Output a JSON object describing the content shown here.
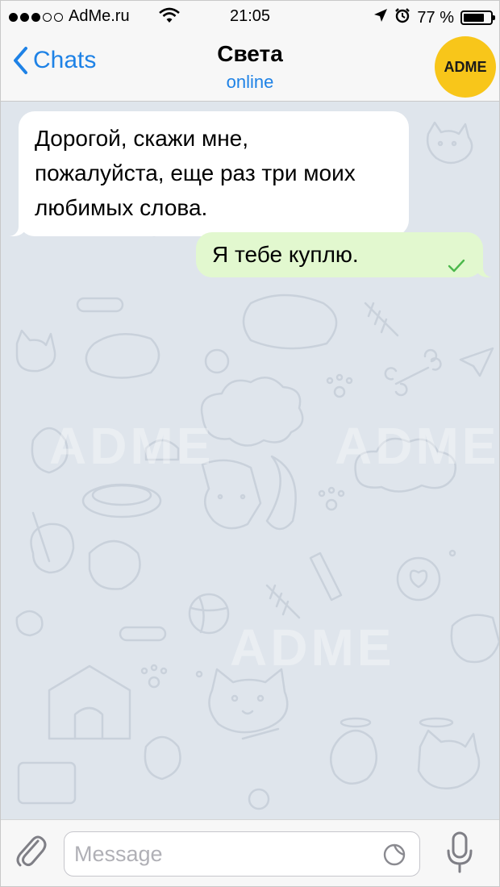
{
  "status_bar": {
    "carrier": "AdMe.ru",
    "time": "21:05",
    "battery": "77 %",
    "signal_strength": "3 of 5",
    "battery_level": 0.77,
    "icons": [
      "signal-dots-icon",
      "wifi-icon",
      "location-arrow-icon",
      "alarm-icon",
      "battery-icon"
    ]
  },
  "header": {
    "back_label": "Chats",
    "title": "Света",
    "status": "online",
    "avatar_text": "ADME",
    "avatar_color": "#f8c61a"
  },
  "messages": [
    {
      "direction": "incoming",
      "lines": [
        "Дорогой, скажи мне,",
        "пожалуйста, еще раз три моих",
        "любимых слова."
      ]
    },
    {
      "direction": "outgoing",
      "text": "Я тебе куплю.",
      "status_icon": "check-icon"
    }
  ],
  "watermark": "ADME",
  "composer": {
    "placeholder": "Message",
    "value": ""
  },
  "colors": {
    "accent": "#1e82e6",
    "outgoing_bubble": "#e2f8cf",
    "incoming_bubble": "#ffffff",
    "wallpaper": "#dfe5ec",
    "check": "#4cb84c"
  }
}
